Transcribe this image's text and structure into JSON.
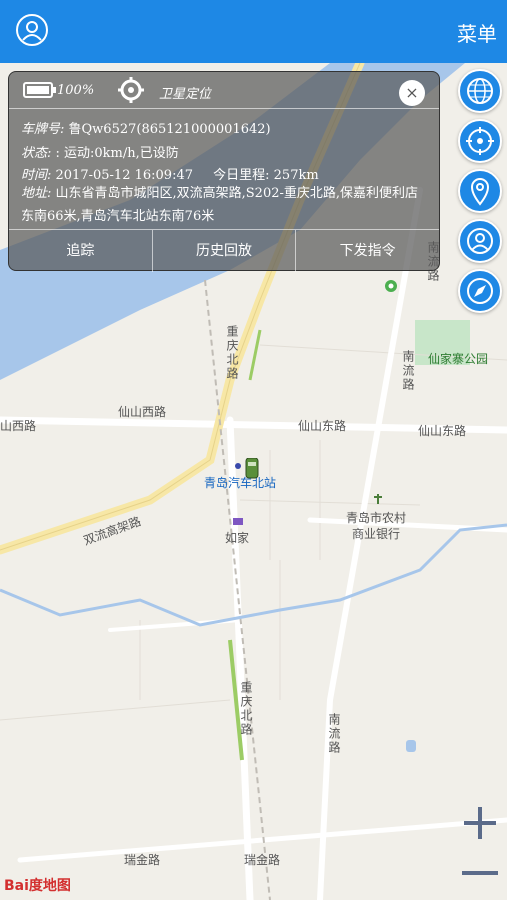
{
  "header": {
    "menu_label": "菜单"
  },
  "panel": {
    "battery": "100%",
    "gps_mode": "卫星定位",
    "plate_label": "车牌号: ",
    "plate": "鲁Qw6527(865121000001642)",
    "status_label": "状态: ",
    "status": ": 运动:0km/h,已设防",
    "time_label": "时间: ",
    "time": "2017-05-12 16:09:47",
    "mileage_label": "今日里程: ",
    "mileage": "257km",
    "address_label": "地址: ",
    "address": "山东省青岛市城阳区,双流高架路,S202-重庆北路,保嘉利便利店东南66米,青岛汽车北站东南76米",
    "buttons": [
      "追踪",
      "历史回放",
      "下发指令"
    ],
    "close": "×"
  },
  "map_labels": {
    "chongqing_north_1": "重庆北路",
    "chongqing_north_2": "重庆北路",
    "xianshan_west_1": "仙山西路",
    "xianshan_west_2": "山西路",
    "xianshan_east_1": "仙山东路",
    "xianshan_east_2": "仙山东路",
    "nanliu_1": "南流路",
    "nanliu_2": "南流路",
    "nanliu_3": "南流路",
    "xianjiazhai_park": "仙家寨公园",
    "bus_station": "青岛汽车北站",
    "shuangliu": "双流高架路",
    "rujia": "如家",
    "bank_line1": "青岛市农村",
    "bank_line2": "商业银行",
    "ruijin_1": "瑞金路",
    "ruijin_2": "瑞金路"
  },
  "logo": "Bai度地图",
  "colors": {
    "accent": "#1e88e5",
    "water": "#a7c6ea",
    "road": "#f7e7a6"
  },
  "icons": [
    "user-icon",
    "battery-icon",
    "gps-target-icon",
    "close-icon",
    "globe-icon",
    "locate-icon",
    "pin-icon",
    "person-icon",
    "compass-icon",
    "zoom-in-icon",
    "zoom-out-icon",
    "car-icon"
  ]
}
